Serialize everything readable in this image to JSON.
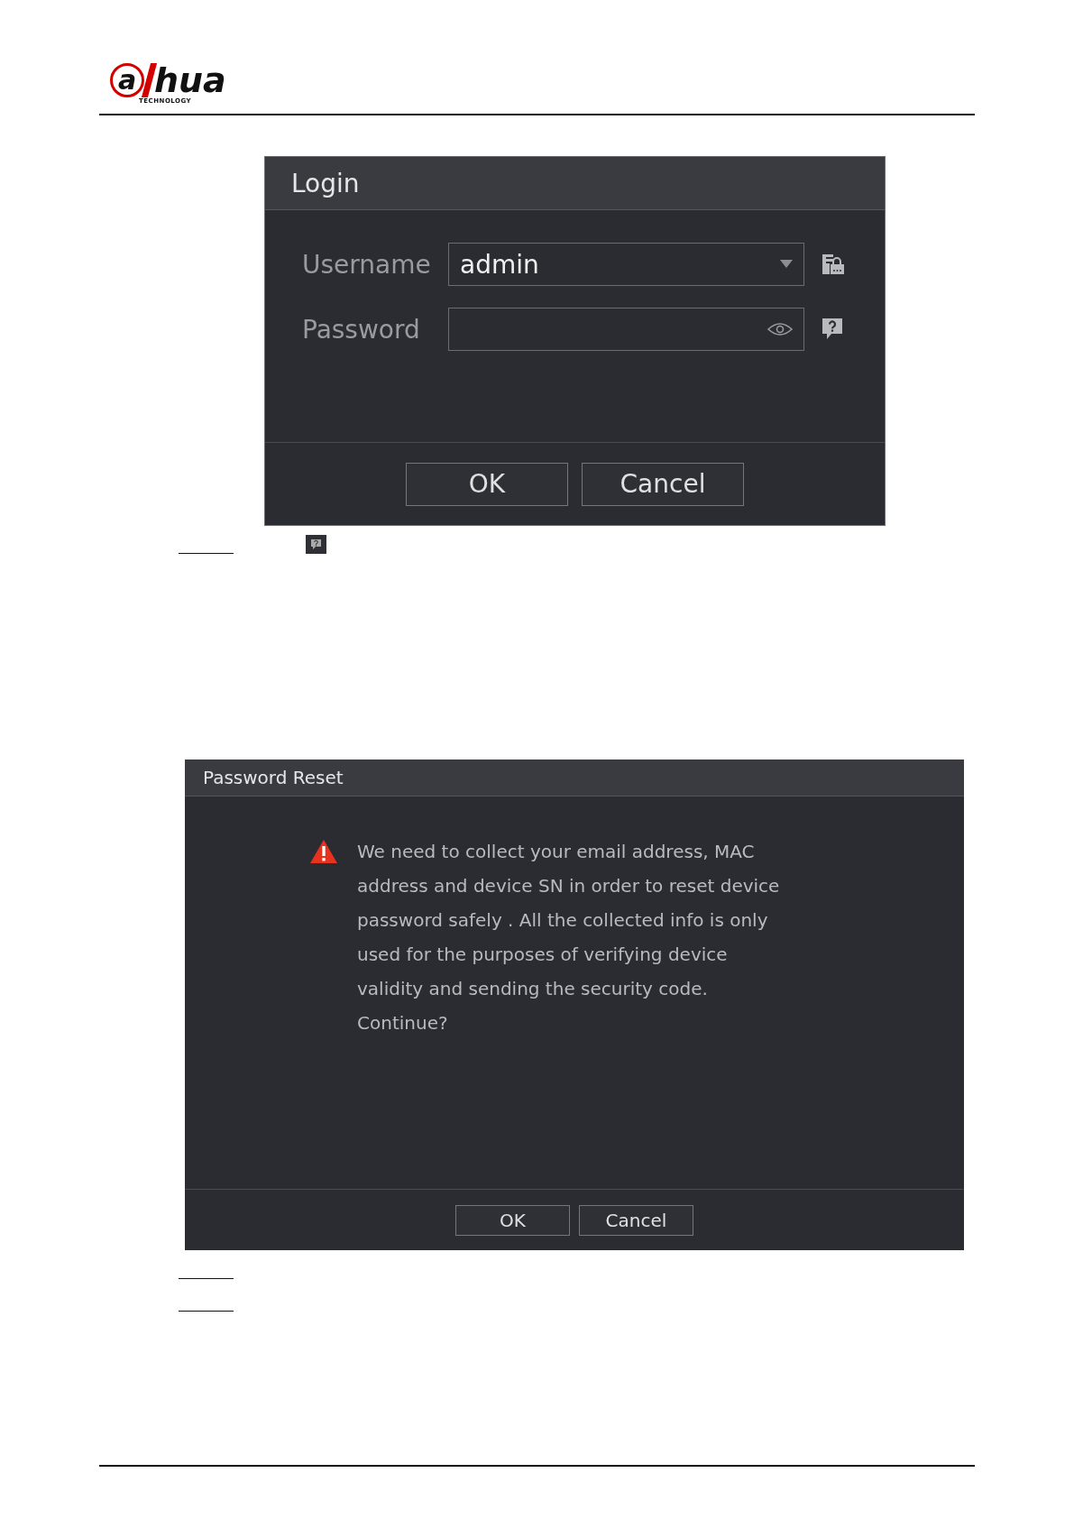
{
  "header": {
    "logo": {
      "mark": "a",
      "name": "hua",
      "tagline": "TECHNOLOGY"
    }
  },
  "login_dialog": {
    "title": "Login",
    "username": {
      "label": "Username",
      "value": "admin"
    },
    "password": {
      "label": "Password"
    },
    "buttons": [
      "OK",
      "Cancel"
    ]
  },
  "password_reset_dialog": {
    "title": "Password Reset",
    "message": "We need to collect your email address, MAC\naddress and device SN in order to reset device\npassword safely . All the collected info is only\nused for the purposes of verifying device\nvalidity and sending the security code.\nContinue?",
    "buttons": [
      "OK",
      "Cancel"
    ]
  }
}
